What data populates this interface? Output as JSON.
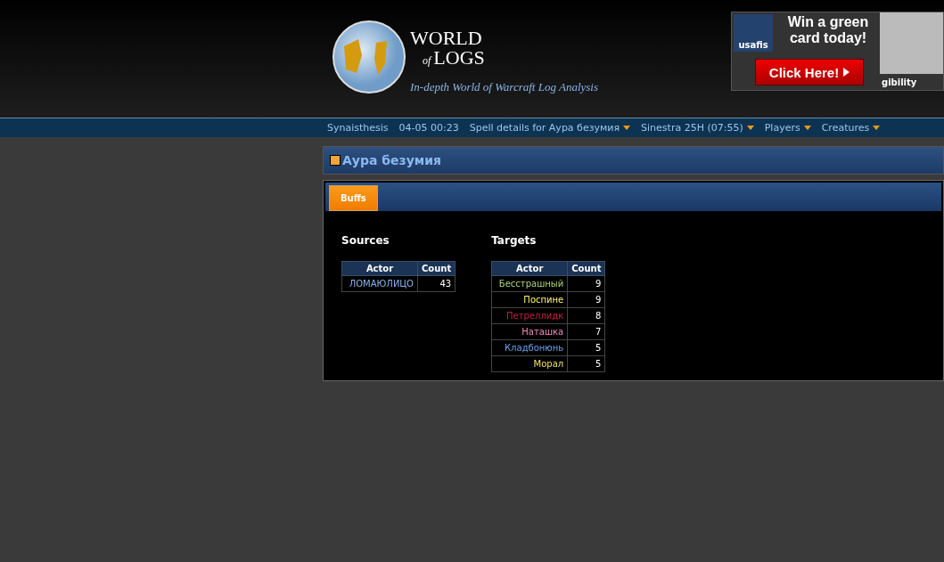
{
  "logo": {
    "title_top": "WORLD",
    "title_of": "of",
    "title_bottom": "LOGS",
    "tagline": "In-depth World of Warcraft Log Analysis"
  },
  "ad": {
    "brand": "usafis",
    "headline": "Win a green card today!",
    "button": "Click Here!",
    "caption": "gibility"
  },
  "nav": [
    {
      "label": "Synaisthesis",
      "dropdown": false
    },
    {
      "label": "04-05 00:23",
      "dropdown": false
    },
    {
      "label": "Spell details for Аура безумия",
      "dropdown": true
    },
    {
      "label": "Sinestra 25H (07:55)",
      "dropdown": true
    },
    {
      "label": "Players",
      "dropdown": true
    },
    {
      "label": "Creatures",
      "dropdown": true
    }
  ],
  "page_title": "Аура безумия",
  "tabs": [
    {
      "label": "Buffs",
      "selected": true
    }
  ],
  "sources": {
    "title": "Sources",
    "columns": [
      "Actor",
      "Count"
    ],
    "rows": [
      {
        "actor": "ЛОМАЮЛИЦО",
        "count": "43",
        "color": "#8ab4f0"
      }
    ]
  },
  "targets": {
    "title": "Targets",
    "columns": [
      "Actor",
      "Count"
    ],
    "rows": [
      {
        "actor": "Бесстрашный",
        "count": "9",
        "color": "#abd473"
      },
      {
        "actor": "Поспине",
        "count": "9",
        "color": "#fff569"
      },
      {
        "actor": "Петреллидк",
        "count": "8",
        "color": "#c41f3b"
      },
      {
        "actor": "Наташка",
        "count": "7",
        "color": "#f58cba"
      },
      {
        "actor": "Кладбонюнь",
        "count": "5",
        "color": "#69a0f0"
      },
      {
        "actor": "Морал",
        "count": "5",
        "color": "#f0e060"
      }
    ]
  }
}
